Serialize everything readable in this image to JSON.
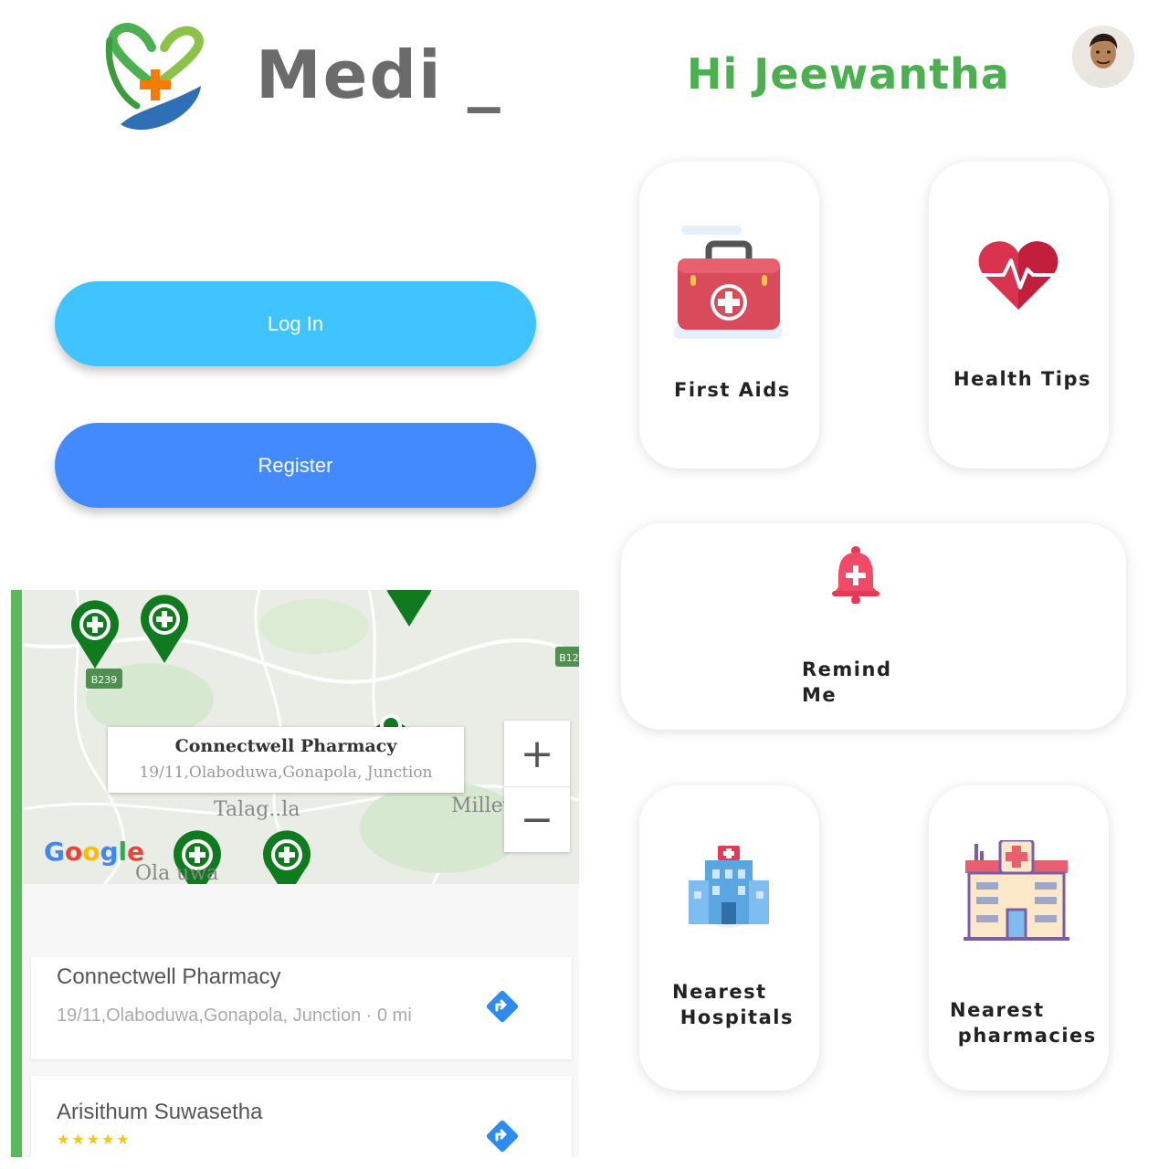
{
  "header": {
    "app_title": "Medi _",
    "greeting": "Hi Jeewantha",
    "logo_icon": "heart-hand-cross-icon",
    "avatar_icon": "user-avatar"
  },
  "auth": {
    "login_label": "Log In",
    "register_label": "Register",
    "login_color": "#40c4ff",
    "register_color": "#448aff"
  },
  "cards": {
    "first_aids": {
      "label": "First Aids",
      "icon": "first-aid-kit-icon"
    },
    "health_tips": {
      "label": "Health Tips",
      "icon": "heart-pulse-icon"
    },
    "remind_me": {
      "label": "Remind\nMe",
      "icon": "bell-plus-icon"
    },
    "nearest_hospitals": {
      "label": "Nearest\n Hospitals",
      "icon": "hospital-building-icon"
    },
    "nearest_pharmacies": {
      "label": "Nearest\n pharmacies",
      "icon": "pharmacy-building-icon"
    }
  },
  "map": {
    "info_title": "Connectwell Pharmacy",
    "info_address": "19/11,Olaboduwa,Gonapola, Junction",
    "zoom_in": "+",
    "zoom_out": "−",
    "label_town1": "Talag..la",
    "label_town2": "Millev..",
    "label_town3": "Ola     uwa",
    "road_badge1": "B239",
    "road_badge2": "B12",
    "google": "Google",
    "places": [
      {
        "name": "Connectwell Pharmacy",
        "address": "19/11,Olaboduwa,Gonapola, Junction · 0 mi"
      },
      {
        "name": "Arisithum Suwasetha",
        "rating": "★★★★★"
      }
    ]
  },
  "colors": {
    "greeting": "#4caf50",
    "title": "#6b6b6b",
    "map_accent": "#5cb85c",
    "pin": "#0f7a1e"
  }
}
